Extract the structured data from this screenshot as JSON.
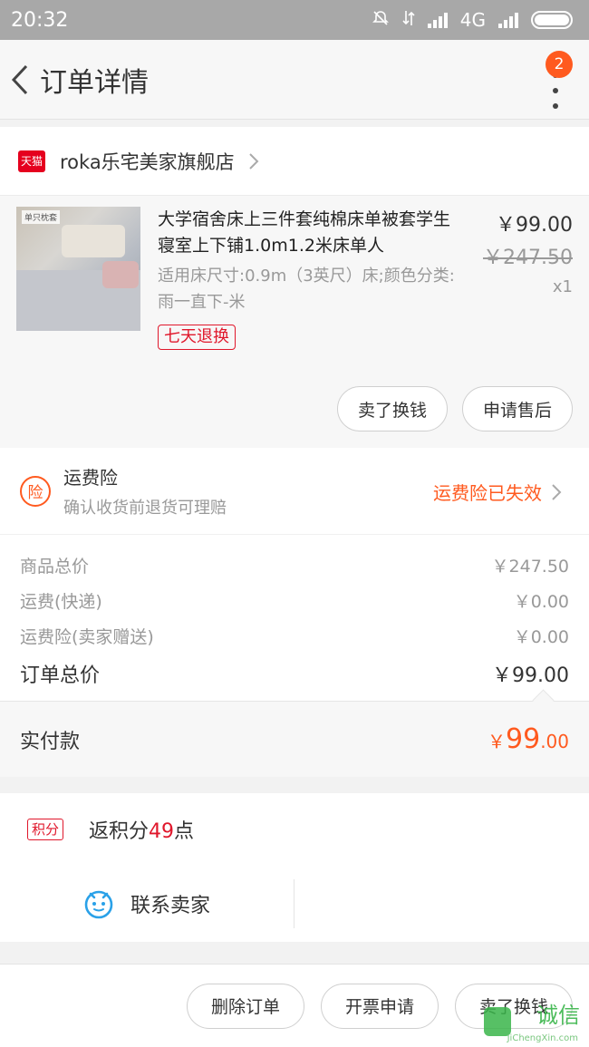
{
  "status_bar": {
    "time": "20:32",
    "network": "4G"
  },
  "header": {
    "title": "订单详情",
    "badge_count": "2"
  },
  "shop": {
    "platform": "天猫",
    "name": "roka乐宅美家旗舰店"
  },
  "product": {
    "thumb_tag": "单只枕套",
    "title": "大学宿舍床上三件套纯棉床单被套学生寝室上下铺1.0m1.2米床单人",
    "spec": "适用床尺寸:0.9m（3英尺）床;颜色分类:雨一直下-米",
    "tag": "七天退换",
    "price": "￥99.00",
    "original_price": "￥247.50",
    "quantity": "x1",
    "buttons": [
      "卖了换钱",
      "申请售后"
    ]
  },
  "insurance": {
    "icon_char": "险",
    "title": "运费险",
    "subtitle": "确认收货前退货可理赔",
    "status": "运费险已失效"
  },
  "summary": {
    "rows": [
      {
        "label": "商品总价",
        "value": "￥247.50"
      },
      {
        "label": "运费(快递)",
        "value": "￥0.00"
      },
      {
        "label": "运费险(卖家赠送)",
        "value": "￥0.00"
      }
    ],
    "total_label": "订单总价",
    "total_value": "￥99.00",
    "paid_label": "实付款",
    "paid_currency": "￥",
    "paid_int": "99",
    "paid_dec": ".00"
  },
  "points": {
    "tag": "积分",
    "prefix": "返积分",
    "value": "49",
    "suffix": "点"
  },
  "contact": {
    "label": "联系卖家"
  },
  "bottom_bar": {
    "buttons": [
      "删除订单",
      "开票申请",
      "卖了换钱"
    ]
  },
  "watermark": {
    "text": "诚信",
    "sub": "JiChengXin.com"
  },
  "colors": {
    "accent": "#ff5a1f",
    "tmall_red": "#e5001e",
    "tag_red": "#e0172b"
  }
}
